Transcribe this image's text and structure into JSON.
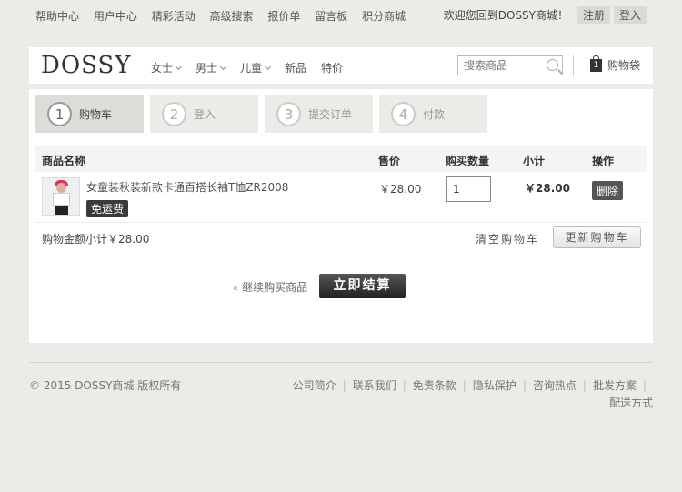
{
  "top": {
    "links": [
      "帮助中心",
      "用户中心",
      "精彩活动",
      "高级搜索",
      "报价单",
      "留言板",
      "积分商城"
    ],
    "welcome": "欢迎您回到DOSSY商城！",
    "register": "注册",
    "login": "登入"
  },
  "header": {
    "logo": "DOSSY",
    "nav": [
      "女士",
      "男士",
      "儿童",
      "新品",
      "特价"
    ],
    "search_placeholder": "搜索商品",
    "cart_count": "1",
    "cart_label": "购物袋"
  },
  "steps": [
    {
      "num": "1",
      "label": "购物车"
    },
    {
      "num": "2",
      "label": "登入"
    },
    {
      "num": "3",
      "label": "提交订单"
    },
    {
      "num": "4",
      "label": "付款"
    }
  ],
  "table": {
    "headers": [
      "商品名称",
      "售价",
      "购买数量",
      "小计",
      "操作"
    ],
    "rows": [
      {
        "name": "女童装秋装新款卡通百搭长袖T恤ZR2008",
        "tag": "免运费",
        "price": "￥28.00",
        "qty": "1",
        "subtotal": "￥28.00",
        "action": "删除"
      }
    ]
  },
  "summary": {
    "total": "购物金额小计￥28.00",
    "clear": "清空购物车",
    "update": "更新购物车"
  },
  "actions": {
    "continue": "继续购买商品",
    "continue_quote": "«",
    "checkout": "立即结算"
  },
  "footer": {
    "copyright": "© 2015 DOSSY商城 版权所有",
    "links": [
      "公司简介",
      "联系我们",
      "免责条款",
      "隐私保护",
      "咨询热点",
      "批发方案",
      "配送方式"
    ]
  }
}
